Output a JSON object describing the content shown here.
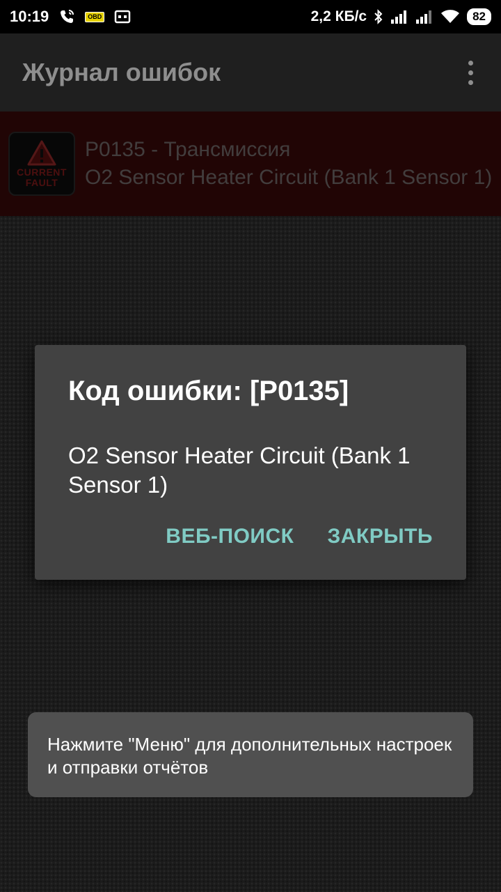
{
  "status_bar": {
    "time": "10:19",
    "obd_label": "OBD",
    "speed": "2,2 КБ/с",
    "battery": "82",
    "icons": [
      "phone-call-icon",
      "obd-icon",
      "cast-icon",
      "bluetooth-icon",
      "signal-icon",
      "signal-icon",
      "wifi-icon",
      "battery-icon"
    ]
  },
  "app_bar": {
    "title": "Журнал ошибок",
    "menu_icon": "overflow-menu-icon"
  },
  "fault_list": {
    "items": [
      {
        "badge_line1": "CURRENT",
        "badge_line2": "FAULT",
        "code": "P0135 - Трансмиссия",
        "description": "O2 Sensor Heater Circuit (Bank 1 Sensor 1)"
      }
    ]
  },
  "dialog": {
    "title": "Код ошибки: [P0135]",
    "message": "O2 Sensor Heater Circuit (Bank 1 Sensor 1)",
    "web_search_label": "ВЕБ-ПОИСК",
    "close_label": "ЗАКРЫТЬ",
    "accent_color": "#80cbc4"
  },
  "toast": {
    "message": "Нажмите \"Меню\" для дополнительных настроек и отправки отчётов"
  },
  "colors": {
    "status_bar": "#000000",
    "app_bar": "#1f1f1f",
    "fault_row": "#3c0a0a",
    "dialog": "#424242",
    "toast": "#505050"
  }
}
